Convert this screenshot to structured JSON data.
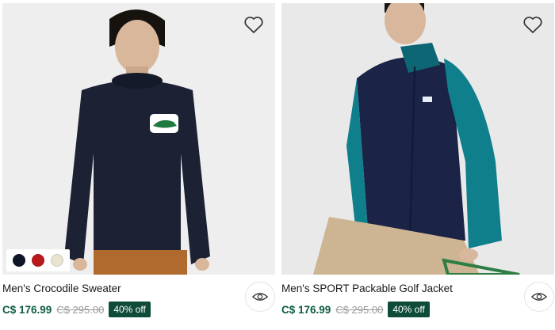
{
  "products": [
    {
      "name": "Men's Crocodile Sweater",
      "price": "C$ 176.99",
      "original_price": "C$ 295.00",
      "discount": "40% off",
      "swatches": [
        "#101729",
        "#b81a1c",
        "#e9e3d2"
      ],
      "wishlist_icon": "heart-outline-icon",
      "quickview_icon": "eye-icon"
    },
    {
      "name": "Men's SPORT Packable Golf Jacket",
      "price": "C$ 176.99",
      "original_price": "C$ 295.00",
      "discount": "40% off",
      "wishlist_icon": "heart-outline-icon",
      "quickview_icon": "eye-icon"
    }
  ],
  "colors": {
    "price": "#0b5a43",
    "badge": "#0e4b39",
    "strike": "#9a9a9a"
  }
}
